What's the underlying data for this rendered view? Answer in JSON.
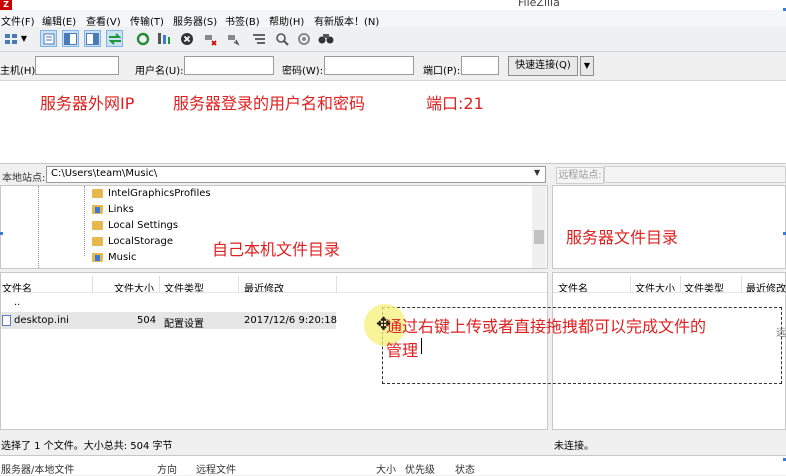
{
  "window": {
    "logo": "Z",
    "title": "FileZilla"
  },
  "menu": [
    "文件(F)",
    "编辑(E)",
    "查看(V)",
    "传输(T)",
    "服务器(S)",
    "书签(B)",
    "帮助(H)",
    "有新版本！(N)"
  ],
  "toolbar": {
    "icons": [
      "site-manager-icon",
      "dropdown-arrow-icon",
      "message-log-icon",
      "local-tree-icon",
      "remote-tree-icon",
      "transfer-queue-icon",
      "refresh-icon",
      "process-queue-icon",
      "cancel-icon",
      "disconnect-icon",
      "reconnect-icon",
      "directory-listing-filter-icon",
      "toggle-compare-icon",
      "sync-browse-icon",
      "search-icon"
    ]
  },
  "quickconnect": {
    "host_label": "主机(H):",
    "user_label": "用户名(U):",
    "pass_label": "密码(W):",
    "port_label": "端口(P):",
    "host_value": "",
    "user_value": "",
    "pass_value": "",
    "port_value": "",
    "button": "快速连接(Q)",
    "dropdown": "▼"
  },
  "annotations": {
    "log_note_1": "服务器外网IP",
    "log_note_2": "服务器登录的用户名和密码",
    "log_note_3": "端口:21",
    "local_dir_note": "自己本机文件目录",
    "remote_dir_note": "服务器文件目录",
    "tip_line_1": "通过右键上传或者直接拖拽都可以完成文件的",
    "tip_line_2": "管理",
    "tip_clip": "远"
  },
  "local_site": {
    "label": "本地站点:",
    "path": "C:\\Users\\team\\Music\\",
    "tree": [
      "IntelGraphicsProfiles",
      "Links",
      "Local Settings",
      "LocalStorage",
      "Music"
    ]
  },
  "remote_site": {
    "label": "远程站点:",
    "path": ""
  },
  "local_files": {
    "columns": [
      "文件名",
      "文件大小",
      "文件类型",
      "最近修改"
    ],
    "rows": [
      {
        "name": "..",
        "size": "",
        "type": "",
        "modified": ""
      },
      {
        "name": "desktop.ini",
        "size": "504",
        "type": "配置设置",
        "modified": "2017/12/6 9:20:18"
      }
    ]
  },
  "remote_files": {
    "columns": [
      "文件名",
      "文件大小",
      "文件类型",
      "最近修改"
    ]
  },
  "status": {
    "local": "选择了 1 个文件。大小总共: 504 字节",
    "remote": "未连接。"
  },
  "queue": {
    "columns": [
      "服务器/本地文件",
      "方向",
      "远程文件",
      "大小",
      "优先级",
      "状态"
    ]
  },
  "colors": {
    "annotation_red": "#e02020",
    "annotation_blue": "#2a52be",
    "toolbar_active": "#cce0f4"
  }
}
